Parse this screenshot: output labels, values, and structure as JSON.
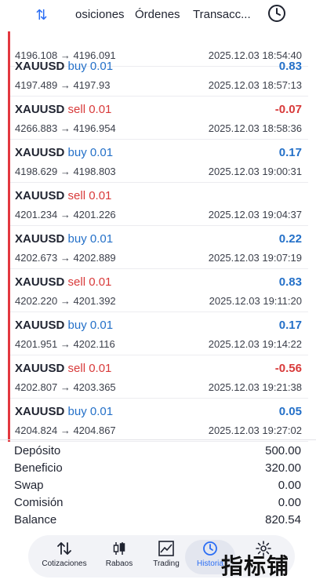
{
  "topbar": {
    "tabs": [
      "osiciones",
      "Órdenes",
      "Transacc..."
    ]
  },
  "trades": [
    {
      "symbol": "",
      "side": "",
      "side_type": "",
      "prices": "4196.108 → 4196.091",
      "profit": "",
      "profit_sign": "pos",
      "time": "2025.12.03 18:54:40"
    },
    {
      "symbol": "XAUUSD",
      "side": "buy 0.01",
      "side_type": "buy",
      "prices": "4197.489 → 4197.93",
      "profit": "0.83",
      "profit_sign": "pos",
      "time": "2025.12.03 18:57:13"
    },
    {
      "symbol": "XAUUSD",
      "side": "sell 0.01",
      "side_type": "sell",
      "prices": "4266.883 → 4196.954",
      "profit": "-0.07",
      "profit_sign": "neg",
      "time": "2025.12.03 18:58:36"
    },
    {
      "symbol": "XAUUSD",
      "side": "buy 0.01",
      "side_type": "buy",
      "prices": "4198.629 → 4198.803",
      "profit": "0.17",
      "profit_sign": "pos",
      "time": "2025.12.03 19:00:31"
    },
    {
      "symbol": "XAUUSD",
      "side": "sell 0.01",
      "side_type": "sell",
      "prices": "4201.234 → 4201.226",
      "profit": "",
      "profit_sign": "pos",
      "time": "2025.12.03 19:04:37"
    },
    {
      "symbol": "XAUUSD",
      "side": "buy 0.01",
      "side_type": "buy",
      "prices": "4202.673 → 4202.889",
      "profit": "0.22",
      "profit_sign": "pos",
      "time": "2025.12.03 19:07:19"
    },
    {
      "symbol": "XAUUSD",
      "side": "sell 0.01",
      "side_type": "sell",
      "prices": "4202.220 → 4201.392",
      "profit": "0.83",
      "profit_sign": "pos",
      "time": "2025.12.03 19:11:20"
    },
    {
      "symbol": "XAUUSD",
      "side": "buy 0.01",
      "side_type": "buy",
      "prices": "4201.951 → 4202.116",
      "profit": "0.17",
      "profit_sign": "pos",
      "time": "2025.12.03 19:14:22"
    },
    {
      "symbol": "XAUUSD",
      "side": "sell 0.01",
      "side_type": "sell",
      "prices": "4202.807 → 4203.365",
      "profit": "-0.56",
      "profit_sign": "neg",
      "time": "2025.12.03 19:21:38"
    },
    {
      "symbol": "XAUUSD",
      "side": "buy 0.01",
      "side_type": "buy",
      "prices": "4204.824 → 4204.867",
      "profit": "0.05",
      "profit_sign": "pos",
      "time": "2025.12.03 19:27:02"
    }
  ],
  "summary": [
    {
      "label": "Depósito",
      "value": "500.00"
    },
    {
      "label": "Beneficio",
      "value": "320.00"
    },
    {
      "label": "Swap",
      "value": "0.00"
    },
    {
      "label": "Comisión",
      "value": "0.00"
    },
    {
      "label": "Balance",
      "value": "820.54"
    }
  ],
  "nav": {
    "items": [
      "Cotizaciones",
      "Rabaos",
      "Trading",
      "Historia"
    ],
    "active": "Historia"
  },
  "watermark": "指标铺",
  "colors": {
    "buy": "#2470c8",
    "sell": "#d83a3a",
    "accent": "#2a6df4"
  }
}
